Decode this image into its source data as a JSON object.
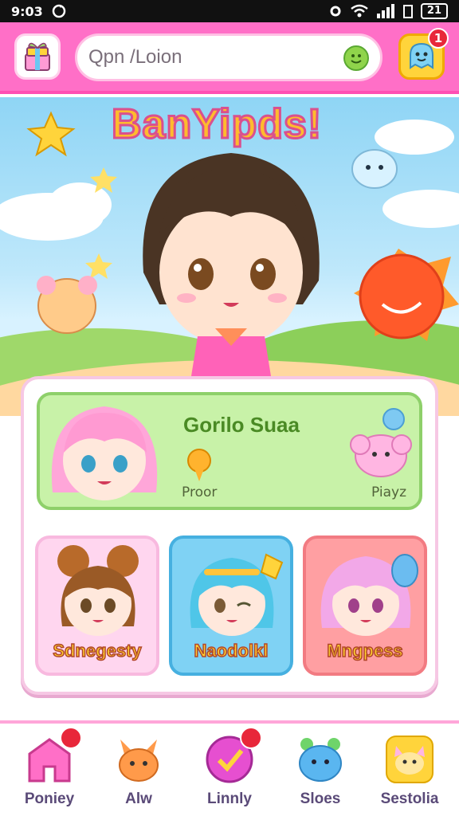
{
  "status_bar": {
    "time": "9:03",
    "battery": "21"
  },
  "header": {
    "search_placeholder": "Qpn /Loion",
    "notification_count": "1"
  },
  "hero": {
    "title": "BanYipds!"
  },
  "featured": {
    "name": "Gorilo Suaa",
    "label_left": "Proor",
    "label_right": "Piayz"
  },
  "characters": [
    {
      "label": "Sdnegesty",
      "color": "#ffd6ef"
    },
    {
      "label": "Naodolkl",
      "color": "#7fd2f4"
    },
    {
      "label": "Mngpess",
      "color": "#ff9fa2"
    }
  ],
  "nav": [
    {
      "label": "Poniey",
      "icon": "house-icon"
    },
    {
      "label": "Alw",
      "icon": "fox-icon"
    },
    {
      "label": "Linnly",
      "icon": "check-icon"
    },
    {
      "label": "Sloes",
      "icon": "blob-icon"
    },
    {
      "label": "Sestolia",
      "icon": "cat-icon"
    }
  ],
  "colors": {
    "header": "#ff6fc7",
    "accent": "#ffd43b",
    "badge": "#e8273a"
  }
}
